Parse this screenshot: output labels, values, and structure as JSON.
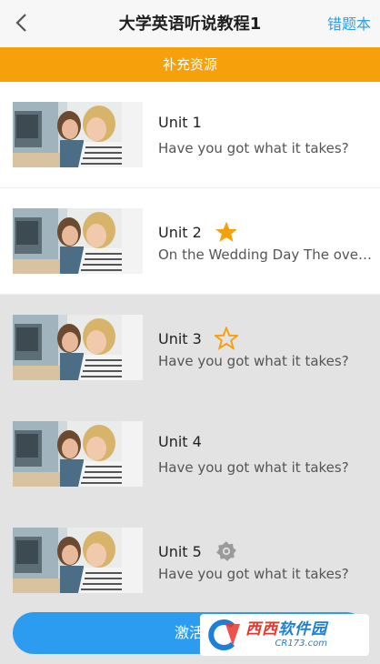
{
  "nav": {
    "back_icon": "chevron-left-icon",
    "title": "大学英语听说教程1",
    "right_label": "错题本"
  },
  "banner": {
    "label": "补充资源",
    "color": "#f6a00b"
  },
  "units": [
    {
      "name": "Unit 1",
      "desc": "Have you got what it takes?",
      "status": "none",
      "locked": false
    },
    {
      "name": "Unit 2",
      "desc": "On the Wedding Day The overwhelming",
      "status": "star-filled",
      "locked": false
    },
    {
      "name": "Unit 3",
      "desc": "Have you got what it takes?",
      "status": "star-outline",
      "locked": true
    },
    {
      "name": "Unit 4",
      "desc": "Have you got what it takes?",
      "status": "none",
      "locked": true
    },
    {
      "name": "Unit 5",
      "desc": "Have you got what it takes?",
      "status": "badge",
      "locked": true
    }
  ],
  "bottom": {
    "button_label": "激活",
    "button_color": "#2b9cf0"
  },
  "watermark": {
    "cn_part1": "西西",
    "cn_part2": "软件园",
    "en": "CR173.com"
  },
  "colors": {
    "accent": "#2f9ee8",
    "star": "#f6a00b",
    "locked_bg": "#e3e3e3"
  }
}
